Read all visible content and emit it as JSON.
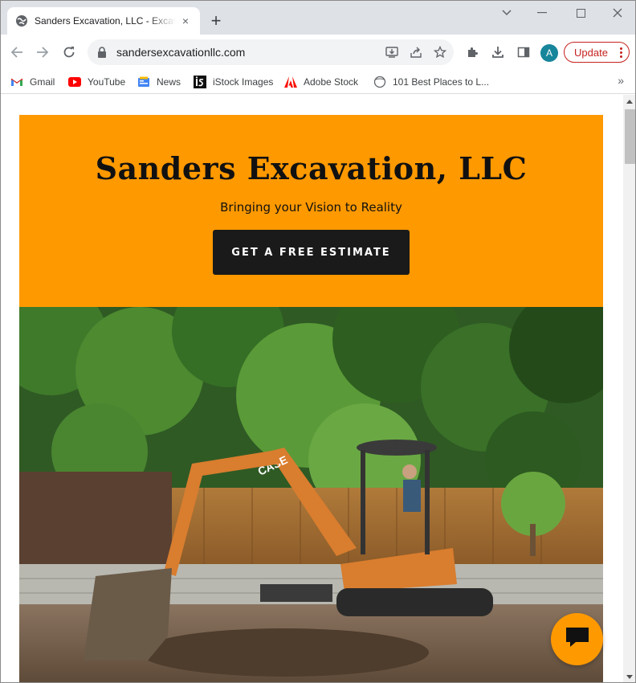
{
  "browser": {
    "tab": {
      "title": "Sanders Excavation, LLC - Excavation",
      "close_label": "×"
    },
    "new_tab_label": "+",
    "url": "sandersexcavationllc.com",
    "profile_initial": "A",
    "update_label": "Update"
  },
  "bookmarks": [
    {
      "label": "Gmail",
      "icon": "gmail-icon"
    },
    {
      "label": "YouTube",
      "icon": "youtube-icon"
    },
    {
      "label": "News",
      "icon": "news-icon"
    },
    {
      "label": "iStock Images",
      "icon": "istock-icon"
    },
    {
      "label": "Adobe Stock",
      "icon": "adobe-icon"
    },
    {
      "label": "101 Best Places to L...",
      "icon": "compass-icon"
    }
  ],
  "bookmarks_more": "»",
  "page": {
    "title": "Sanders Excavation, LLC",
    "tagline": "Bringing your Vision to Reality",
    "cta_label": "GET A FREE ESTIMATE",
    "machine_brand": "CASE",
    "accent_color": "#ff9900",
    "button_color": "#1a1a1a"
  }
}
